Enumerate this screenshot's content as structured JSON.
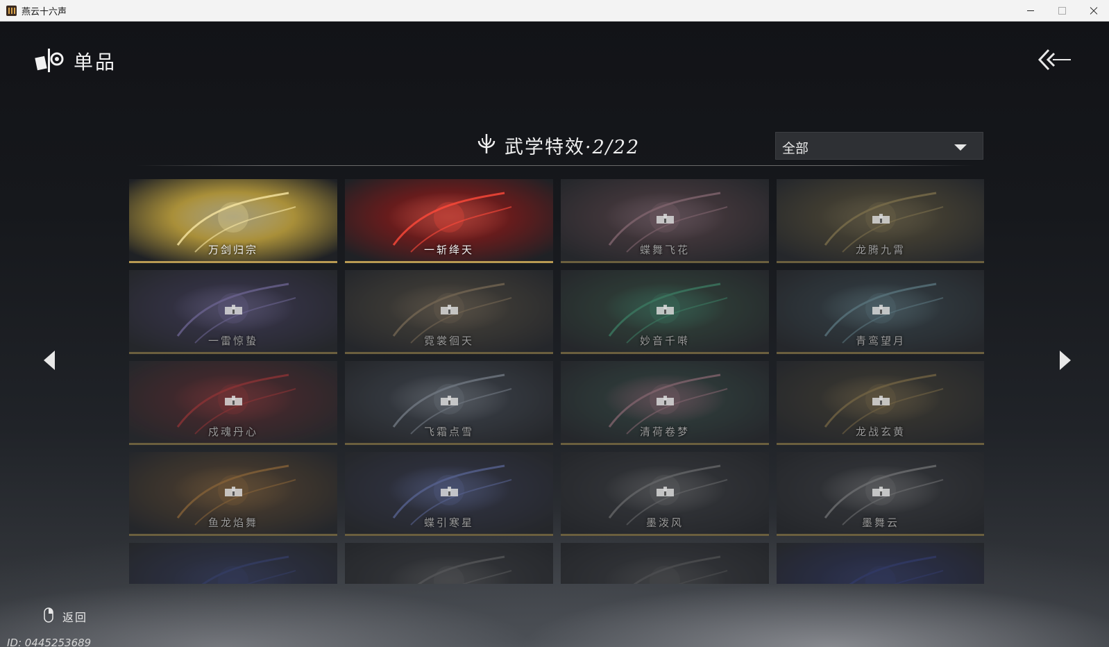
{
  "window": {
    "title": "燕云十六声"
  },
  "header": {
    "title": "单品"
  },
  "section": {
    "title": "武学特效",
    "count": "·2/22"
  },
  "filter": {
    "selected": "全部"
  },
  "cards": [
    {
      "name": "万剑归宗",
      "locked": false,
      "tint": "#b79a3a",
      "accent": "#f7e6a3"
    },
    {
      "name": "一斩绛天",
      "locked": false,
      "tint": "#6e1a1a",
      "accent": "#ff4a3a"
    },
    {
      "name": "蝶舞飞花",
      "locked": true,
      "tint": "#5a3f44",
      "accent": "#e7a7b8"
    },
    {
      "name": "龙腾九霄",
      "locked": true,
      "tint": "#5d5232",
      "accent": "#d9bb6a"
    },
    {
      "name": "一雷惊蛰",
      "locked": true,
      "tint": "#3c3658",
      "accent": "#b6a3ff"
    },
    {
      "name": "霓裳徊天",
      "locked": true,
      "tint": "#4d4638",
      "accent": "#c9a97a"
    },
    {
      "name": "妙音千啭",
      "locked": true,
      "tint": "#2f4a3a",
      "accent": "#4fd39a"
    },
    {
      "name": "青鸾望月",
      "locked": true,
      "tint": "#33434a",
      "accent": "#8fc8d6"
    },
    {
      "name": "戍魂丹心",
      "locked": true,
      "tint": "#5a2225",
      "accent": "#ff3b3b"
    },
    {
      "name": "飞霜点雪",
      "locked": true,
      "tint": "#3f4650",
      "accent": "#c4d2e2"
    },
    {
      "name": "清荷卷梦",
      "locked": true,
      "tint": "#2f4640",
      "accent": "#e7a4b4"
    },
    {
      "name": "龙战玄黄",
      "locked": true,
      "tint": "#3f3a2c",
      "accent": "#c7a45a"
    },
    {
      "name": "鱼龙焰舞",
      "locked": true,
      "tint": "#5b4328",
      "accent": "#f0a040"
    },
    {
      "name": "蝶引寒星",
      "locked": true,
      "tint": "#2f3248",
      "accent": "#8aa0ff"
    },
    {
      "name": "墨泼风",
      "locked": true,
      "tint": "#34363a",
      "accent": "#aaaaaa"
    },
    {
      "name": "墨舞云",
      "locked": true,
      "tint": "#34363a",
      "accent": "#bbbbbb"
    },
    {
      "name": "",
      "locked": true,
      "tint": "#2a3050",
      "accent": "#4050a0"
    },
    {
      "name": "",
      "locked": true,
      "tint": "#34363a",
      "accent": "#888888"
    },
    {
      "name": "",
      "locked": true,
      "tint": "#34363a",
      "accent": "#777777"
    },
    {
      "name": "",
      "locked": true,
      "tint": "#252c5a",
      "accent": "#3a4aa8"
    }
  ],
  "hint": {
    "label": "返回"
  },
  "footer": {
    "player_id": "ID: 0445253689"
  }
}
